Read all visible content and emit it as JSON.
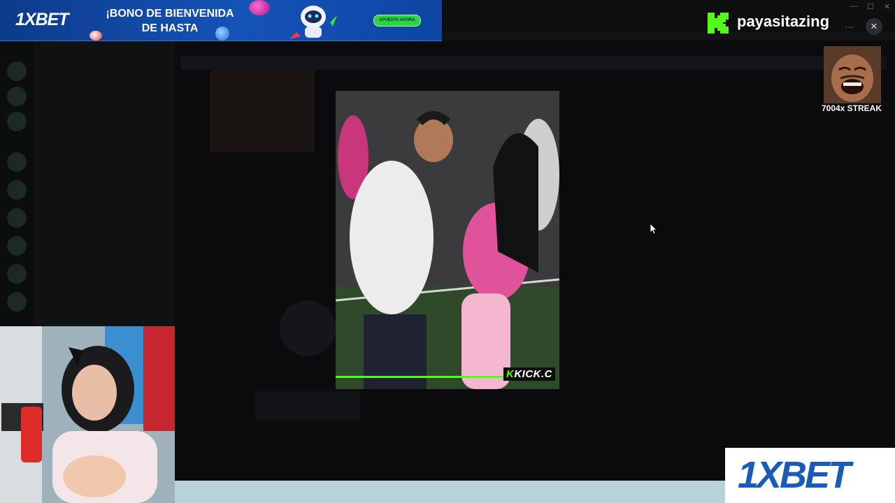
{
  "ad_top": {
    "logo": "1XBET",
    "headline_line1": "¡BONO DE BIENVENIDA",
    "headline_line2": "DE HASTA",
    "cta": "APUESTA AHORA"
  },
  "kick_badge": {
    "channel_name": "payasitazing",
    "icon": "kick-logo-icon"
  },
  "streak": {
    "label": "7004x STREAK"
  },
  "video": {
    "watermark": "KICK.C",
    "progress": 0.75
  },
  "ad_bottom_right": {
    "logo": "1XBET"
  },
  "colors": {
    "kick_green": "#53fc18",
    "xbet_blue": "#1a5bb8"
  }
}
